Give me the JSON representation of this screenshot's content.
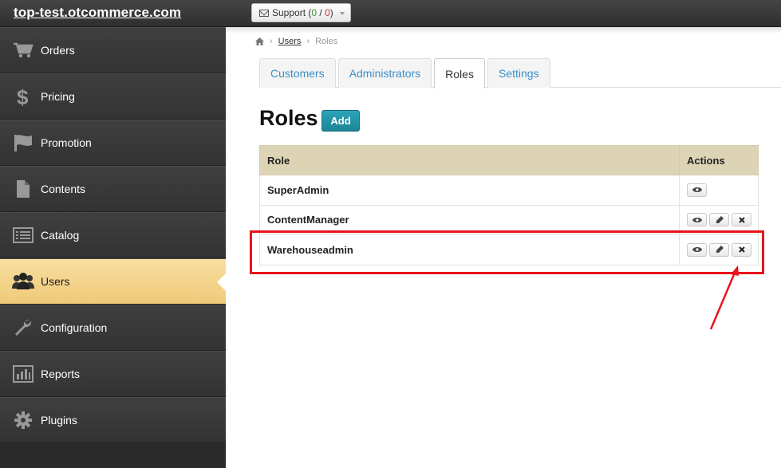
{
  "header": {
    "site_title": "top-test.otcommerce.com",
    "support_label": "Support (",
    "support_green": "0",
    "support_sep": " / ",
    "support_red": "0",
    "support_close": ")"
  },
  "sidebar": {
    "items": [
      {
        "label": "Orders",
        "icon": "cart-icon"
      },
      {
        "label": "Pricing",
        "icon": "dollar-icon"
      },
      {
        "label": "Promotion",
        "icon": "flag-icon"
      },
      {
        "label": "Contents",
        "icon": "document-icon"
      },
      {
        "label": "Catalog",
        "icon": "list-icon"
      },
      {
        "label": "Users",
        "icon": "users-icon",
        "active": true
      },
      {
        "label": "Configuration",
        "icon": "wrench-icon"
      },
      {
        "label": "Reports",
        "icon": "chart-icon"
      },
      {
        "label": "Plugins",
        "icon": "gear-icon"
      }
    ]
  },
  "breadcrumb": {
    "link": "Users",
    "current": "Roles",
    "separator": "›"
  },
  "tabs": [
    {
      "label": "Customers"
    },
    {
      "label": "Administrators"
    },
    {
      "label": "Roles",
      "active": true
    },
    {
      "label": "Settings"
    }
  ],
  "page": {
    "title": "Roles",
    "add_label": "Add"
  },
  "table": {
    "headers": {
      "role": "Role",
      "actions": "Actions"
    },
    "rows": [
      {
        "role": "SuperAdmin"
      },
      {
        "role": "ContentManager"
      },
      {
        "role": "Warehouseadmin"
      }
    ]
  },
  "colors": {
    "accent": "#1e8597",
    "active_sidebar": "#efc978",
    "table_header": "#ddd4b6",
    "annotation": "#e8131b"
  }
}
